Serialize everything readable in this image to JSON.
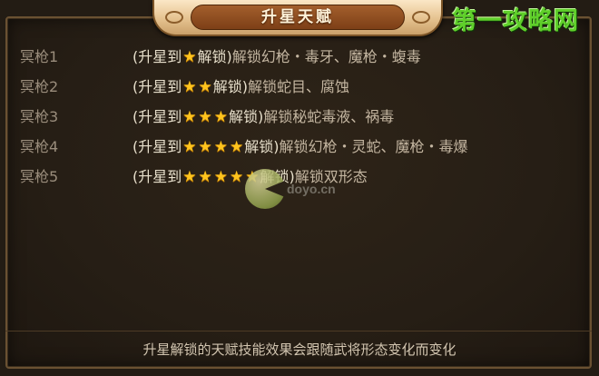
{
  "title": "升星天赋",
  "watermark": "第一攻略网",
  "logo_text": "doyo.cn",
  "rows": [
    {
      "label": "冥枪1",
      "unlock_open": "(升星到",
      "stars": 1,
      "unlock_close": "解锁)",
      "desc": "解锁幻枪・毒牙、魔枪・蝮毒"
    },
    {
      "label": "冥枪2",
      "unlock_open": "(升星到",
      "stars": 2,
      "unlock_close": "解锁)",
      "desc": "解锁蛇目、腐蚀"
    },
    {
      "label": "冥枪3",
      "unlock_open": "(升星到",
      "stars": 3,
      "unlock_close": "解锁)",
      "desc": "解锁秘蛇毒液、祸毒"
    },
    {
      "label": "冥枪4",
      "unlock_open": "(升星到",
      "stars": 4,
      "unlock_close": "解锁)",
      "desc": "解锁幻枪・灵蛇、魔枪・毒爆"
    },
    {
      "label": "冥枪5",
      "unlock_open": "(升星到",
      "stars": 5,
      "unlock_close": "解锁)",
      "desc": "解锁双形态"
    }
  ],
  "footer": "升星解锁的天赋技能效果会跟随武将形态变化而变化",
  "colors": {
    "star": "#ffc41d",
    "watermark": "#5fcf2a",
    "panel": "#261e15",
    "title_plate": "#e5c28f"
  },
  "icons": {
    "star": "star-icon"
  }
}
